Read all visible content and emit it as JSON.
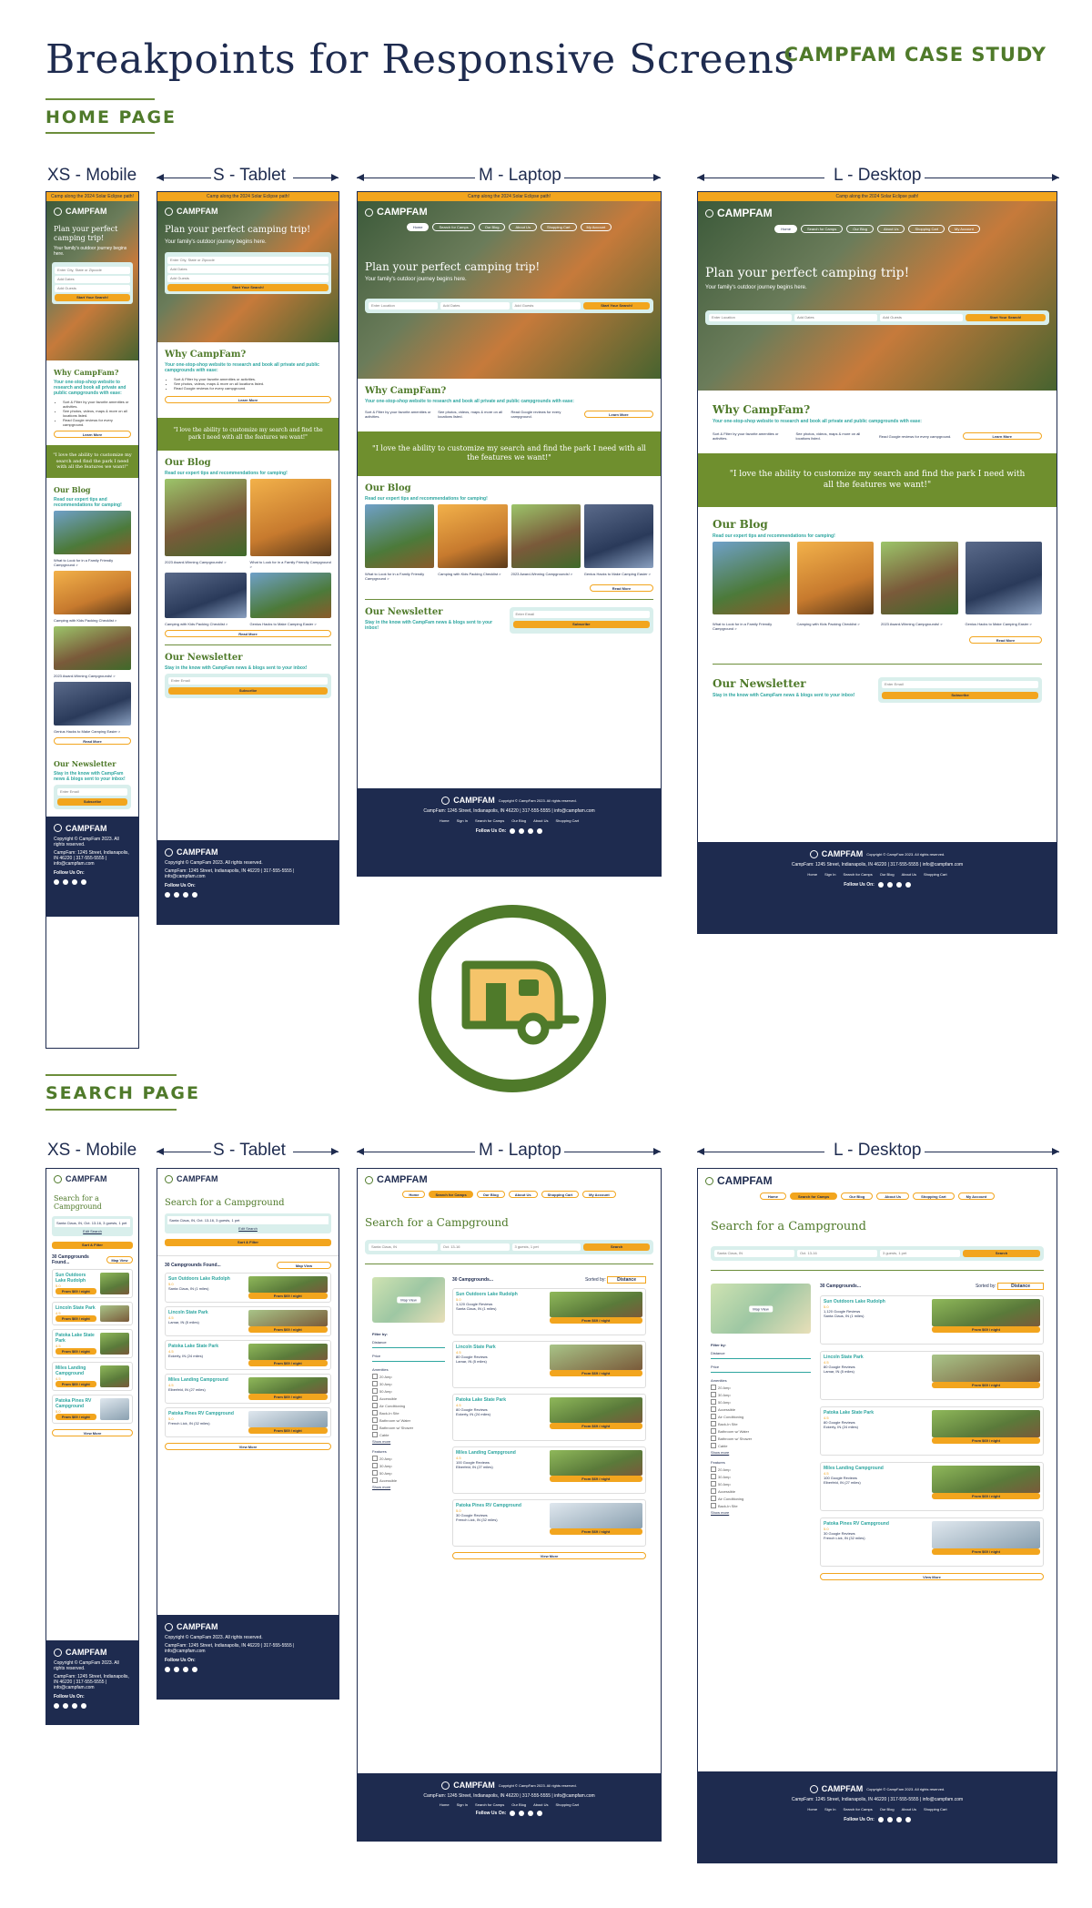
{
  "page": {
    "title": "Breakpoints for Responsive Screens",
    "brand_tag": "CAMPFAM CASE STUDY",
    "sections": {
      "home": "HOME PAGE",
      "search": "SEARCH PAGE"
    }
  },
  "breakpoints": [
    {
      "label": "XS - Mobile"
    },
    {
      "label": "S - Tablet"
    },
    {
      "label": "M - Laptop"
    },
    {
      "label": "L - Desktop"
    }
  ],
  "home": {
    "banner": "Camp along the 2024 Solar Eclipse path!",
    "logo": "CAMPFAM",
    "nav": [
      "Home",
      "Search for Camps",
      "Our Blog",
      "About Us",
      "Shopping Cart",
      "My Account"
    ],
    "hero_title": "Plan your perfect camping trip!",
    "hero_sub": "Your family's outdoor journey begins here.",
    "search_fields": [
      "Enter City, State or Zipcode",
      "Add Dates",
      "Add Guests"
    ],
    "search_fields_short": [
      "Enter Location",
      "Add Dates",
      "Add Guests"
    ],
    "search_button": "Start Your Search!",
    "why_title": "Why CampFam?",
    "why_tag": "Your one-stop-shop website to research and book all private and public campgrounds with ease:",
    "why_points": [
      "Sort & Filter by your favorite amenities or activities.",
      "See photos, videos, maps & more on all locations listed.",
      "Read Google reviews for every campground."
    ],
    "learn_more": "Learn More",
    "quote": "\"I love the ability to customize my search and find the park I need with all the features we want!\"",
    "blog_title": "Our Blog",
    "blog_tag": "Read our expert tips and recommendations for camping!",
    "blog_posts": [
      "What to Look for in a Family Friendly Campground >",
      "Camping with Kids Packing Checklist >",
      "2023 Award-Winning Campgrounds! >",
      "Genius Hacks to Make Camping Easier >"
    ],
    "read_more": "Read More",
    "news_title": "Our Newsletter",
    "news_tag": "Stay in the know with CampFam news & blogs sent to your inbox!",
    "email_placeholder": "Enter Email",
    "subscribe": "Subscribe",
    "footer_copy": "Copyright © CampFam 2023. All rights reserved.",
    "footer_address": "CampFam: 1245 Street, Indianapolis, IN 46220 | 317-555-5555 | info@campfam.com",
    "footer_links": [
      "Home",
      "Sign In",
      "Search for Camps",
      "Our Blog",
      "About Us",
      "Shopping Cart"
    ],
    "follow": "Follow Us On:"
  },
  "search": {
    "title": "Search for a Campground",
    "location": "Santa Claus, IN",
    "dates": "Oct. 13-16",
    "guests": "3 guests, 1 pet",
    "search_button": "Search",
    "edit_search": "Edit Search",
    "sort_filter": "Sort & Filter",
    "count": "30 Campgrounds Found...",
    "count_short": "30 Campgrounds...",
    "sorted_by": "Sorted by:",
    "sort_value": "Distance",
    "map_view": "Map View",
    "filter_by": "Filter by:",
    "filter_groups": [
      "Distance",
      "Price",
      "Amenities",
      "Features"
    ],
    "amenities": [
      "20 Amp",
      "30 Amp",
      "50 Amp",
      "Accessible",
      "Air Conditioning",
      "Back-In Site",
      "Bathroom w/ Water",
      "Bathroom w/ Shower",
      "Cable"
    ],
    "show_more": "Show more",
    "view_more": "View More",
    "results": [
      {
        "name": "Sun Outdoors Lake Rudolph",
        "rating": "5.0",
        "reviews": "1,120 Google Reviews",
        "loc": "Santa Claus, IN (1 miles)",
        "types": "Tents, RVs, Lodging",
        "price": "From $69 / night"
      },
      {
        "name": "Lincoln State Park",
        "rating": "4.5",
        "reviews": "80 Google Reviews",
        "loc": "Lamar, IN (5 miles)",
        "types": "Tents, RVs, Lodging",
        "price": "From $69 / night"
      },
      {
        "name": "Patoka Lake State Park",
        "rating": "4.5",
        "reviews": "80 Google Reviews",
        "loc": "Eckerty, IN (24 miles)",
        "types": "Tents, RVs, Lodging",
        "price": "From $69 / night"
      },
      {
        "name": "Miles Landing Campground",
        "rating": "4.5",
        "reviews": "100 Google Reviews",
        "loc": "Elberfeld, IN (27 miles)",
        "types": "Tents, RVs",
        "price": "From $69 / night"
      },
      {
        "name": "Patoka Pines RV Campground",
        "rating": "5.0",
        "reviews": "30 Google Reviews",
        "loc": "French Lick, IN (32 miles)",
        "types": "RVs",
        "price": "From $69 / night"
      }
    ]
  },
  "colors": {
    "navy": "#1e2b4f",
    "green": "#4f7a2a",
    "orange": "#f2a51e",
    "teal": "#2ea6a0",
    "mint": "#d9efec"
  }
}
